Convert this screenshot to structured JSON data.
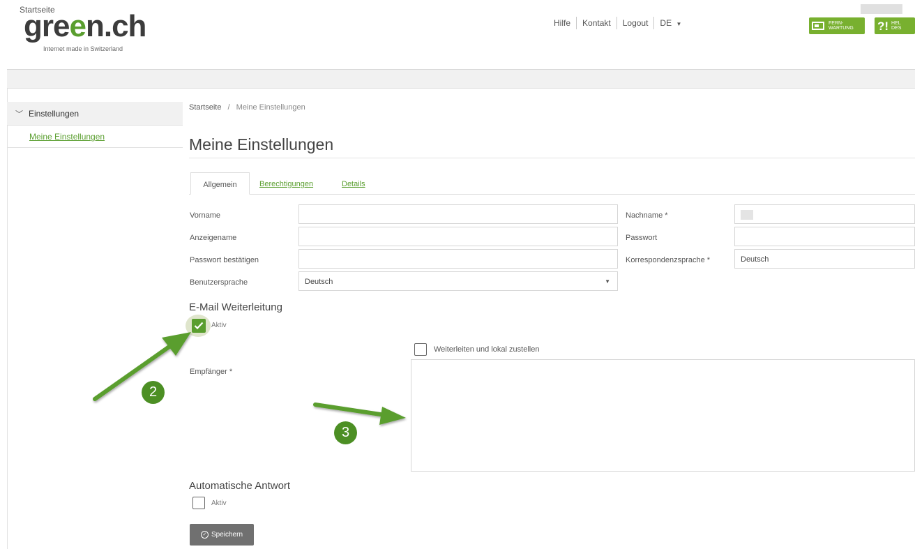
{
  "logo": {
    "brand_pre": "gre",
    "brand_accent": "e",
    "brand_post": "n.ch",
    "tagline": "Internet made in Switzerland"
  },
  "topnav": {
    "hilfe": "Hilfe",
    "kontakt": "Kontakt",
    "logout": "Logout",
    "language": "DE",
    "caret_icon": "caret-down-icon"
  },
  "badges": {
    "fernwartung_line1": "FERN-",
    "fernwartung_line2": "WARTUNG",
    "helpdesk_mark": "?!",
    "helpdesk_line1": "HEL",
    "helpdesk_line2": "DES"
  },
  "crumbbar": {
    "label": "Startseite"
  },
  "sidebar": {
    "group_label": "Einstellungen",
    "item_label": "Meine Einstellungen"
  },
  "breadcrumb": {
    "home": "Startseite",
    "separator": "/",
    "current": "Meine Einstellungen"
  },
  "page_title": "Meine Einstellungen",
  "tabs": {
    "allgemein": "Allgemein",
    "berechtigungen": "Berechtigungen",
    "details": "Details"
  },
  "form": {
    "vorname_label": "Vorname",
    "vorname_value": "",
    "nachname_label": "Nachname *",
    "anzeigename_label": "Anzeigename",
    "anzeigename_value": "",
    "passwort_label": "Passwort",
    "passwort_value": "",
    "passwort_bestaetigen_label": "Passwort bestätigen",
    "passwort_bestaetigen_value": "",
    "korrespondenz_label": "Korrespondenzsprache *",
    "korrespondenz_value": "Deutsch",
    "benutzersprache_label": "Benutzersprache",
    "benutzersprache_value": "Deutsch"
  },
  "email_forwarding": {
    "title": "E-Mail Weiterleitung",
    "aktiv_label": "Aktiv",
    "aktiv_checked": true,
    "local_delivery_label": "Weiterleiten und lokal zustellen",
    "local_delivery_checked": false,
    "recipient_label": "Empfänger *",
    "recipient_value": ""
  },
  "auto_reply": {
    "title": "Automatische Antwort",
    "aktiv_label": "Aktiv",
    "aktiv_checked": false
  },
  "save_button": {
    "label": "Speichern"
  },
  "annotations": {
    "step2": "2",
    "step3": "3",
    "arrow_color": "#5a9e2f"
  },
  "colors": {
    "brand_green": "#5a9e2f",
    "button_grey": "#707070",
    "sidebar_bg": "#f1f1f1"
  }
}
